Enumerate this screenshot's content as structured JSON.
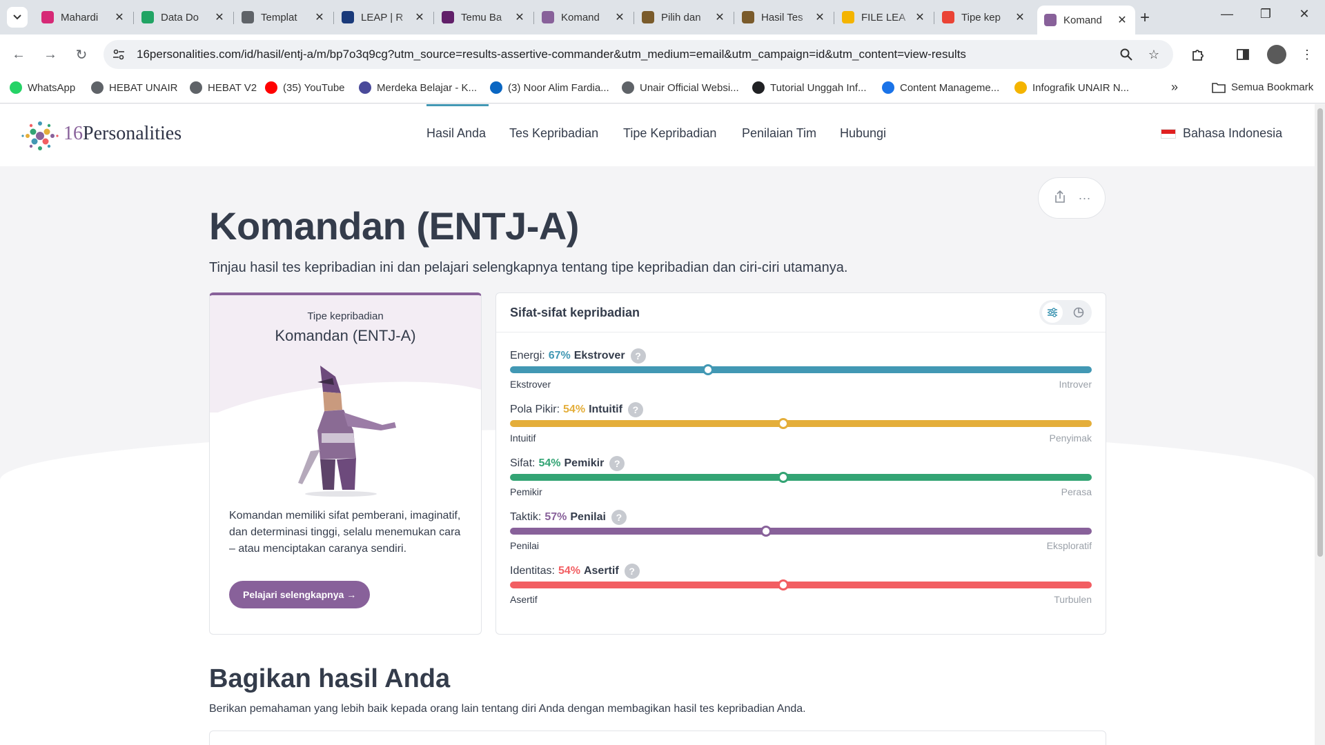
{
  "browser": {
    "tabs": [
      {
        "title": "Mahardi",
        "favicon": "instagram-icon",
        "color": "#d62976"
      },
      {
        "title": "Data Do",
        "favicon": "sheets-icon",
        "color": "#21a464"
      },
      {
        "title": "Templat",
        "favicon": "globe-icon",
        "color": "#5f6368"
      },
      {
        "title": "LEAP | R",
        "favicon": "leap-icon",
        "color": "#1a3a7a"
      },
      {
        "title": "Temu Ba",
        "favicon": "slack-icon",
        "color": "#611f69"
      },
      {
        "title": "Komand",
        "favicon": "16p-icon",
        "color": "#88619a"
      },
      {
        "title": "Pilih dan",
        "favicon": "form-icon",
        "color": "#7a5b2b"
      },
      {
        "title": "Hasil Tes",
        "favicon": "form-icon",
        "color": "#7a5b2b"
      },
      {
        "title": "FILE LEA",
        "favicon": "drive-icon",
        "color": "#f4b400"
      },
      {
        "title": "Tipe kep",
        "favicon": "gmail-icon",
        "color": "#ea4335"
      },
      {
        "title": "Komand",
        "favicon": "16p-icon",
        "color": "#88619a",
        "active": true
      }
    ],
    "url": "16personalities.com/id/hasil/entj-a/m/bp7o3q9cg?utm_source=results-assertive-commander&utm_medium=email&utm_campaign=id&utm_content=view-results",
    "bookmarks": [
      {
        "label": "WhatsApp",
        "color": "#25d366"
      },
      {
        "label": "HEBAT UNAIR",
        "color": "#5f6368"
      },
      {
        "label": "HEBAT V2",
        "color": "#5f6368"
      },
      {
        "label": "(35) YouTube",
        "color": "#ff0000"
      },
      {
        "label": "Merdeka Belajar - K...",
        "color": "#4a4a9a"
      },
      {
        "label": "(3) Noor Alim Fardia...",
        "color": "#0a66c2"
      },
      {
        "label": "Unair Official Websi...",
        "color": "#5f6368"
      },
      {
        "label": "Tutorial Unggah Inf...",
        "color": "#202124"
      },
      {
        "label": "Content Manageme...",
        "color": "#1a73e8"
      },
      {
        "label": "Infografik UNAIR N...",
        "color": "#f4b400"
      }
    ],
    "bookmarks_overflow": "»",
    "all_bookmarks": "Semua Bookmark"
  },
  "site": {
    "logo_num": "16",
    "logo_word": "Personalities",
    "nav": [
      "Hasil Anda",
      "Tes Kepribadian",
      "Tipe Kepribadian",
      "Penilaian Tim",
      "Hubungi"
    ],
    "language": "Bahasa Indonesia"
  },
  "page": {
    "title": "Komandan (ENTJ-A)",
    "subtitle": "Tinjau hasil tes kepribadian ini dan pelajari selengkapnya tentang tipe kepribadian dan ciri-ciri utamanya."
  },
  "type_card": {
    "label": "Tipe kepribadian",
    "name": "Komandan (ENTJ-A)",
    "description": "Komandan memiliki sifat pemberani, imaginatif, dan determinasi tinggi, selalu menemukan cara – atau menciptakan caranya sendiri.",
    "button": "Pelajari selengkapnya →"
  },
  "traits": {
    "title": "Sifat-sifat kepribadian",
    "items": [
      {
        "label": "Energi:",
        "percent": "67%",
        "dominant": "Ekstrover",
        "left": "Ekstrover",
        "right": "Introver",
        "position": 0.34,
        "color": "#4298b4"
      },
      {
        "label": "Pola Pikir:",
        "percent": "54%",
        "dominant": "Intuitif",
        "left": "Intuitif",
        "right": "Penyimak",
        "position": 0.47,
        "color": "#e4ae3a"
      },
      {
        "label": "Sifat:",
        "percent": "54%",
        "dominant": "Pemikir",
        "left": "Pemikir",
        "right": "Perasa",
        "position": 0.47,
        "color": "#33a474"
      },
      {
        "label": "Taktik:",
        "percent": "57%",
        "dominant": "Penilai",
        "left": "Penilai",
        "right": "Eksploratif",
        "position": 0.44,
        "color": "#88619a"
      },
      {
        "label": "Identitas:",
        "percent": "54%",
        "dominant": "Asertif",
        "left": "Asertif",
        "right": "Turbulen",
        "position": 0.47,
        "color": "#f25e62"
      }
    ]
  },
  "share": {
    "title": "Bagikan hasil Anda",
    "subtitle": "Berikan pemahaman yang lebih baik kepada orang lain tentang diri Anda dengan membagikan hasil tes kepribadian Anda."
  }
}
